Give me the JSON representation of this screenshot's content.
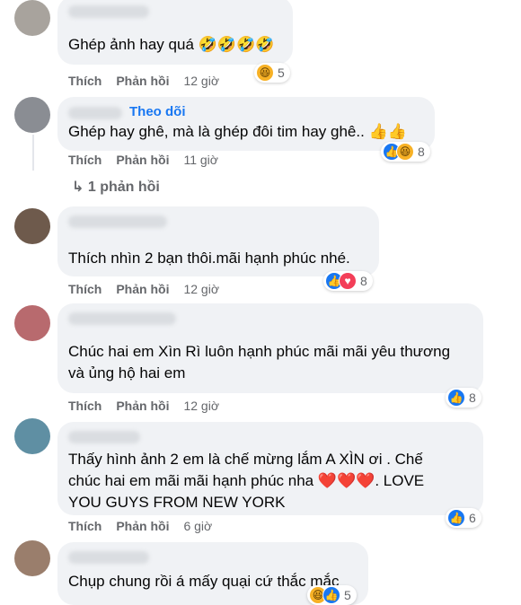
{
  "comments": [
    {
      "text": "Ghép ảnh hay quá 🤣🤣🤣🤣",
      "reaction_count": "5",
      "time": "12 giờ"
    },
    {
      "text": "Ghép hay ghê, mà là ghép đôi tim hay ghê.. 👍👍",
      "follow": "Theo dõi",
      "reaction_count": "8",
      "time": "11 giờ"
    },
    {
      "text": "Thích nhìn 2 bạn thôi.mãi hạnh phúc nhé.",
      "reaction_count": "8",
      "time": "12 giờ"
    },
    {
      "text": "Chúc hai em Xìn Rì luôn hạnh phúc mãi mãi yêu thương\nvà ủng hộ hai em",
      "reaction_count": "8",
      "time": "12 giờ"
    },
    {
      "text": "Thấy hình ảnh 2 em là chế mừng lắm A XÌN ơi . Chế\nchúc hai em mãi mãi hạnh phúc nha ❤️❤️❤️. LOVE\nYOU GUYS FROM NEW YORK",
      "reaction_count": "6",
      "time": "6 giờ"
    },
    {
      "text": "Chụp chung rồi á mấy quại cứ thắc mắc",
      "reaction_count": "5"
    }
  ],
  "actions": {
    "like": "Thích",
    "reply": "Phản hồi"
  },
  "replies_link": "↳ 1 phản hồi",
  "colors": {
    "bubble": "#f0f2f5",
    "secondary_text": "#65676b",
    "link": "#1877f2"
  }
}
